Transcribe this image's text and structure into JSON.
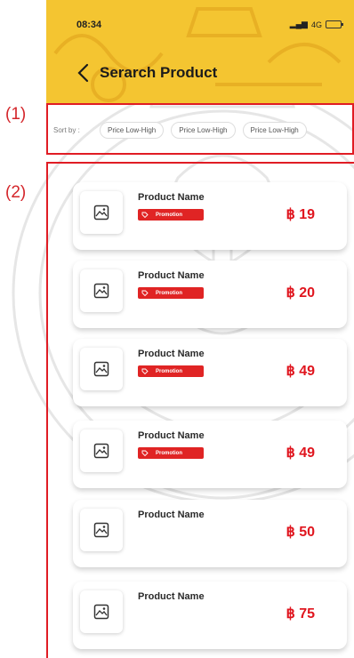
{
  "annotations": {
    "label1": "(1)",
    "label2": "(2)"
  },
  "status": {
    "time": "08:34",
    "network": "4G"
  },
  "header": {
    "title": "Serarch Product",
    "back_icon": "chevron-left-icon"
  },
  "sort": {
    "label": "Sort by :",
    "options": [
      "Price Low-High",
      "Price Low-High",
      "Price Low-High"
    ]
  },
  "products": [
    {
      "name": "Product Name",
      "price": "฿ 19",
      "promotion": "Promotion"
    },
    {
      "name": "Product Name",
      "price": "฿ 20",
      "promotion": "Promotion"
    },
    {
      "name": "Product Name",
      "price": "฿ 49",
      "promotion": "Promotion"
    },
    {
      "name": "Product Name",
      "price": "฿ 49",
      "promotion": "Promotion"
    },
    {
      "name": "Product Name",
      "price": "฿ 50"
    },
    {
      "name": "Product Name",
      "price": "฿ 75"
    }
  ],
  "colors": {
    "header": "#f4c531",
    "accent": "#e0161f",
    "annotation": "#d4262b"
  }
}
